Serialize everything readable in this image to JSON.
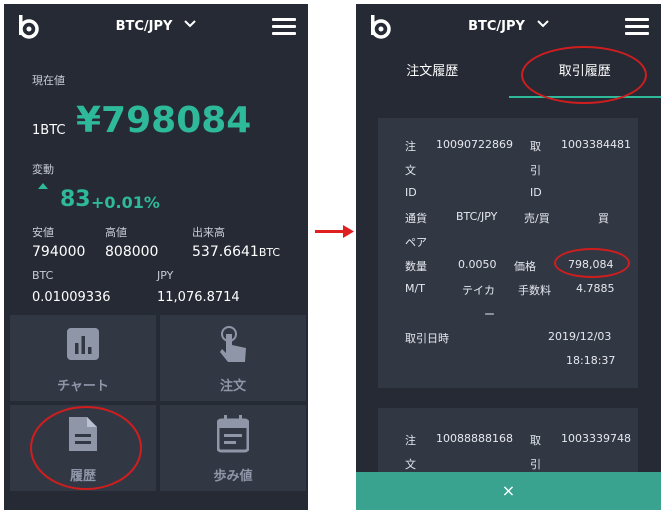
{
  "left": {
    "pair": "BTC/JPY",
    "current_label": "現在値",
    "unit": "1BTC",
    "price": "¥798084",
    "change_label": "変動",
    "change_value": "83",
    "change_pct": "+0.01%",
    "low_label": "安値",
    "low": "794000",
    "high_label": "高値",
    "high": "808000",
    "volume_label": "出来高",
    "volume": "537.6641",
    "volume_unit": "BTC",
    "btc_label": "BTC",
    "btc": "0.01009336",
    "jpy_label": "JPY",
    "jpy": "11,076.8714",
    "tiles": {
      "chart": "チャート",
      "order": "注文",
      "history": "履歴",
      "trades": "歩み値"
    }
  },
  "right": {
    "pair": "BTC/JPY",
    "tab_orders": "注文履歴",
    "tab_trades": "取引履歴",
    "card1": {
      "order_id_label_a": "注",
      "order_id_label_b": "文",
      "order_id_label_c": "ID",
      "order_id": "10090722869",
      "trade_id_label_a": "取",
      "trade_id_label_b": "引",
      "trade_id_label_c": "ID",
      "trade_id": "1003384481",
      "pair_label_a": "通貨",
      "pair_label_b": "ペア",
      "pair": "BTC/JPY",
      "side_label": "売/買",
      "side": "買",
      "qty_label": "数量",
      "qty": "0.0050",
      "price_label": "価格",
      "price": "798,084",
      "mt_label": "M/T",
      "mt_a": "テイカ",
      "mt_b": "ー",
      "fee_label": "手数料",
      "fee": "4.7885",
      "date_label": "取引日時",
      "date": "2019/12/03",
      "time": "18:18:37"
    },
    "card2": {
      "order_id_label_a": "注",
      "order_id_label_b": "文",
      "order_id": "10088888168",
      "trade_id_label_a": "取",
      "trade_id_label_b": "引",
      "trade_id": "1003339748"
    },
    "close_icon": "×"
  },
  "colors": {
    "bg": "#262a35",
    "tile": "#323744",
    "accent": "#2fb99b",
    "highlight": "#d01e1e"
  }
}
